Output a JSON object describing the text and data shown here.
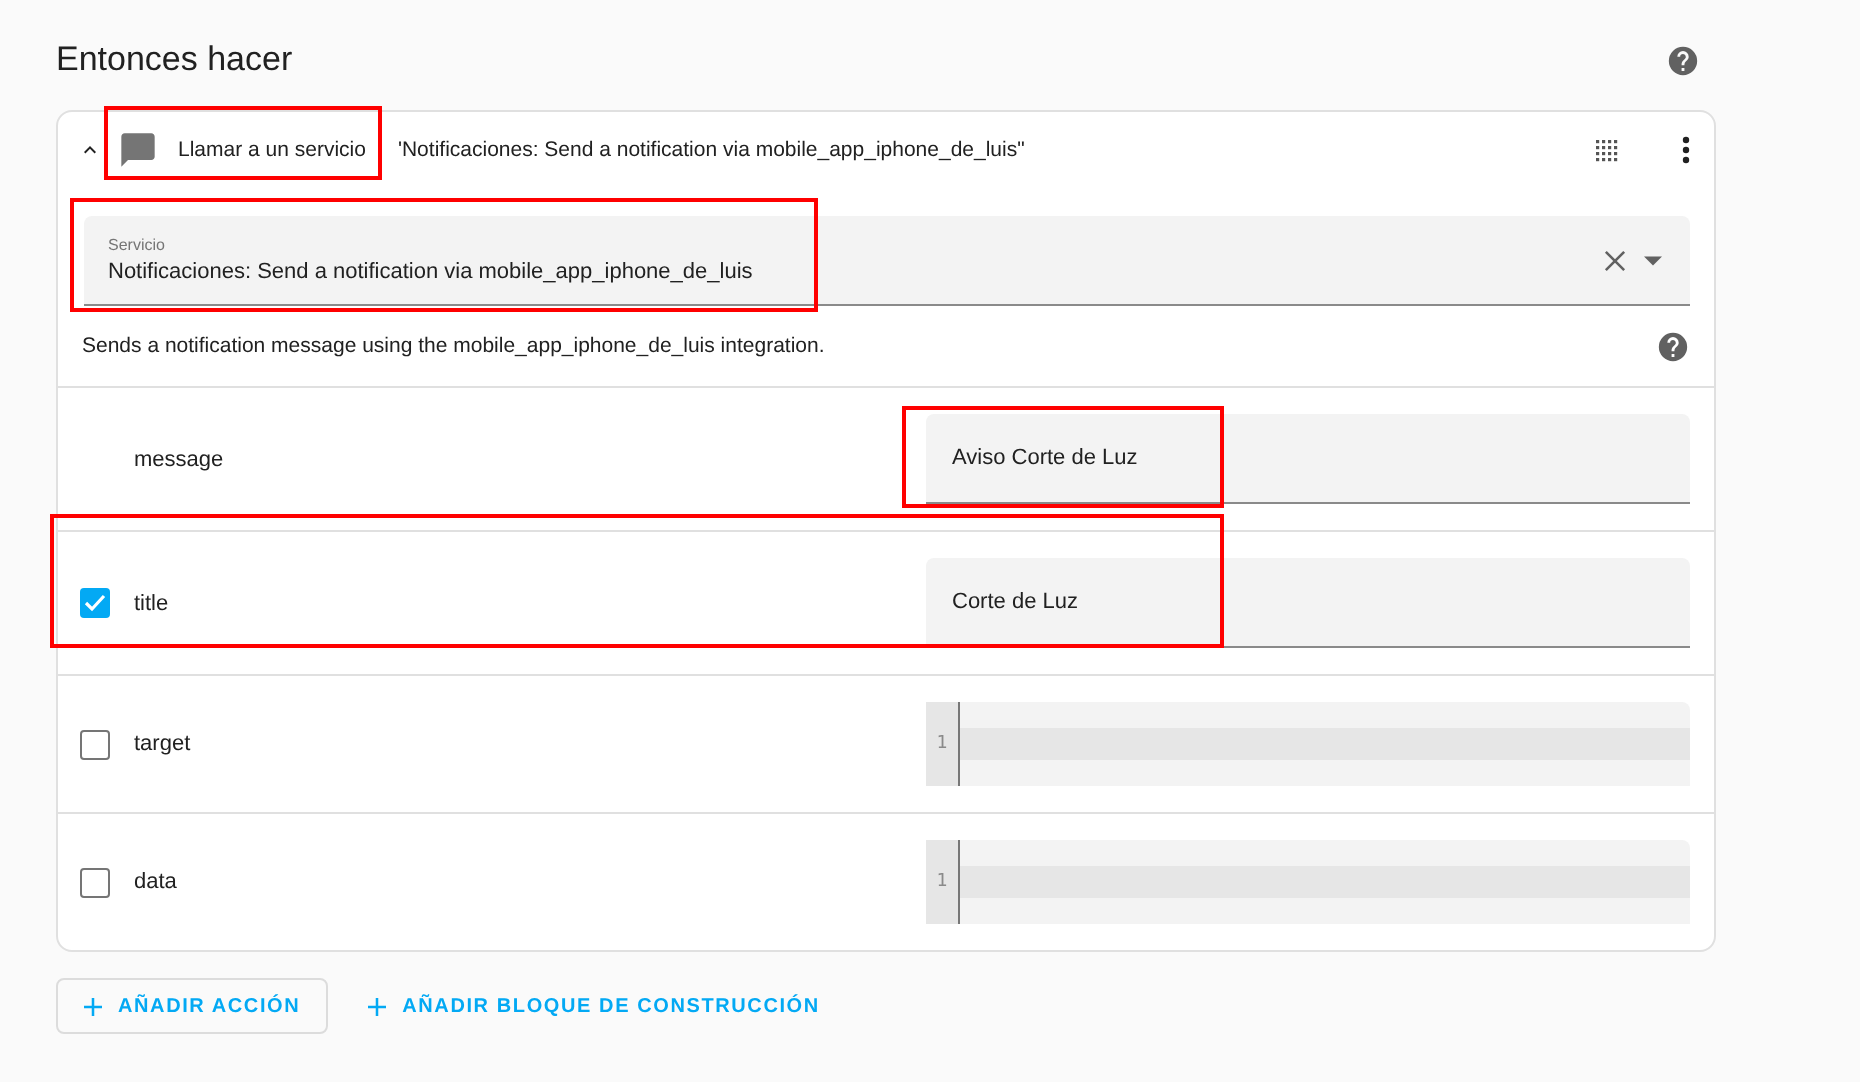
{
  "section_title": "Entonces hacer",
  "action": {
    "expanded": true,
    "type_label": "Llamar a un servicio",
    "detail": "'Notificaciones: Send a notification via mobile_app_iphone_de_luis\"",
    "service_field": {
      "label": "Servicio",
      "value": "Notificaciones: Send a notification via mobile_app_iphone_de_luis"
    },
    "description": "Sends a notification message using the mobile_app_iphone_de_luis integration.",
    "fields": [
      {
        "name": "message",
        "kind": "text",
        "value": "Aviso Corte de Luz"
      },
      {
        "name": "title",
        "kind": "text",
        "checked": true,
        "value": "Corte de Luz"
      },
      {
        "name": "target",
        "kind": "code",
        "checked": false,
        "line_number": "1"
      },
      {
        "name": "data",
        "kind": "code",
        "checked": false,
        "line_number": "1"
      }
    ]
  },
  "buttons": [
    {
      "label": "AÑADIR ACCIÓN",
      "kind": "outlined"
    },
    {
      "label": "AÑADIR BLOQUE DE CONSTRUCCIÓN",
      "kind": "text"
    }
  ]
}
